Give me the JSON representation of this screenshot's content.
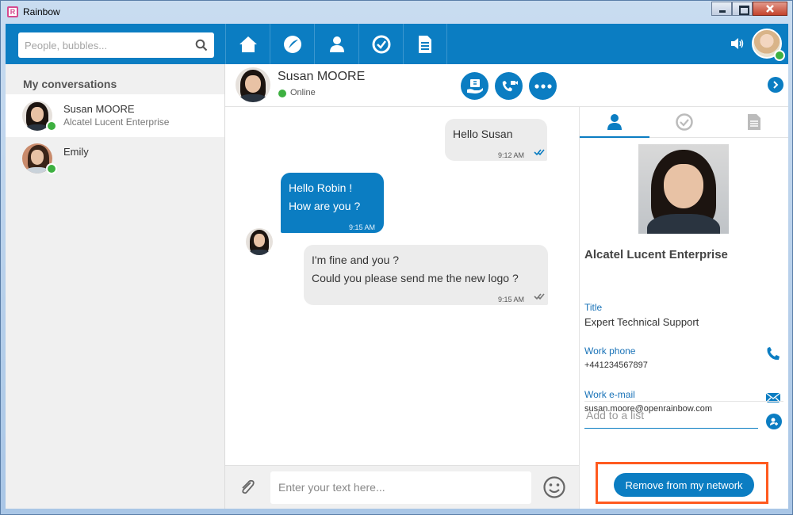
{
  "window": {
    "title": "Rainbow",
    "app_icon_letter": "R"
  },
  "search": {
    "placeholder": "People, bubbles..."
  },
  "nav": {
    "tabs": [
      "home-icon",
      "activity-icon",
      "contacts-icon",
      "history-icon",
      "files-icon"
    ]
  },
  "sidebar": {
    "title": "My conversations",
    "conversations": [
      {
        "name": "Susan MOORE",
        "subtitle": "Alcatel Lucent Enterprise",
        "status": "online"
      },
      {
        "name": "Emily",
        "subtitle": "",
        "status": "online"
      }
    ]
  },
  "chat": {
    "contact_name": "Susan MOORE",
    "presence": "Online",
    "messages": [
      {
        "from": "me",
        "lines": [
          "Hello Susan"
        ],
        "time": "9:12 AM"
      },
      {
        "from": "contact",
        "lines": [
          "Hello Robin !",
          "How are you ?"
        ],
        "time": "9:15 AM"
      },
      {
        "from": "me",
        "lines": [
          "I'm fine and you ?",
          "Could you please send me the new logo ?"
        ],
        "time": "9:15 AM"
      }
    ],
    "composer_placeholder": "Enter your text here..."
  },
  "profile": {
    "company": "Alcatel Lucent Enterprise",
    "title_label": "Title",
    "title_value": "Expert Technical Support",
    "phone_label": "Work phone",
    "phone_value": "+441234567897",
    "email_label": "Work e-mail",
    "email_value": "susan.moore@openrainbow.com",
    "add_list_placeholder": "Add to a list",
    "remove_button": "Remove from my network"
  },
  "colors": {
    "brand_blue": "#0b7dc2",
    "online_green": "#3db040",
    "highlight_orange": "#ff5a1f"
  }
}
